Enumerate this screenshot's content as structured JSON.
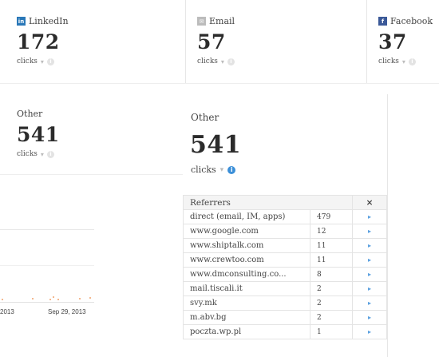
{
  "cards": [
    {
      "name": "LinkedIn",
      "label": "LinkedIn",
      "count": "172",
      "unit": "clicks",
      "icon": "linkedin-icon",
      "color": "#2a78b8"
    },
    {
      "name": "Email",
      "label": "Email",
      "count": "57",
      "unit": "clicks",
      "icon": "email-icon",
      "color": "#bcbcbc"
    },
    {
      "name": "Facebook",
      "label": "Facebook",
      "count": "37",
      "unit": "clicks",
      "icon": "facebook-icon",
      "color": "#3b5998"
    },
    {
      "name": "Other",
      "label": "Other",
      "count": "541",
      "unit": "clicks"
    }
  ],
  "panel": {
    "title": "Other",
    "count": "541",
    "unit": "clicks",
    "accent": "#3b8fd8",
    "referrers_header": "Referrers",
    "close_symbol": "×",
    "rows": [
      {
        "name": "direct (email, IM, apps)",
        "value": "479"
      },
      {
        "name": "www.google.com",
        "value": "12"
      },
      {
        "name": "www.shiptalk.com",
        "value": "11"
      },
      {
        "name": "www.crewtoo.com",
        "value": "11"
      },
      {
        "name": "www.dmconsulting.co...",
        "value": "8"
      },
      {
        "name": "mail.tiscali.it",
        "value": "2"
      },
      {
        "name": "svy.mk",
        "value": "2"
      },
      {
        "name": "m.abv.bg",
        "value": "2"
      },
      {
        "name": "poczta.wp.pl",
        "value": "1"
      }
    ],
    "row_arrow": "▸"
  },
  "timeline": {
    "labels": [
      "2013",
      "Sep 29, 2013"
    ]
  }
}
